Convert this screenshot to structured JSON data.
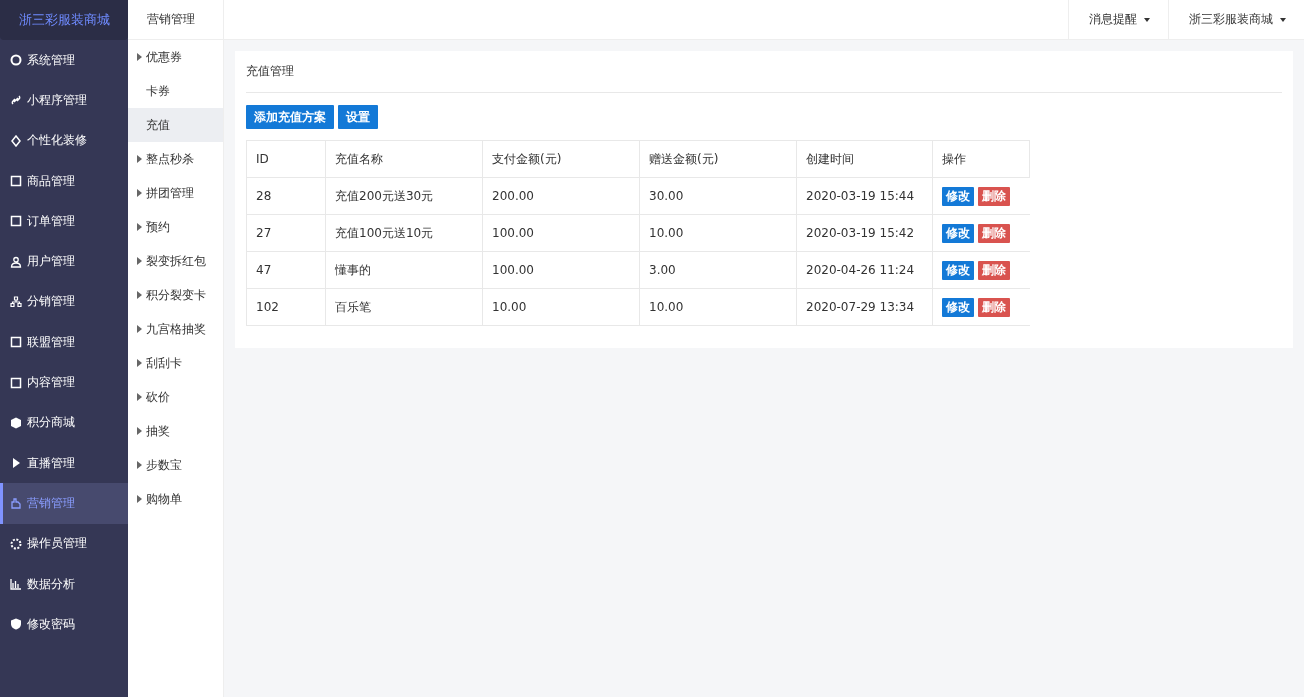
{
  "brand": {
    "title": "浙三彩服装商城"
  },
  "sidebar": {
    "items": [
      {
        "label": "系统管理",
        "selected": false
      },
      {
        "label": "小程序管理",
        "selected": false
      },
      {
        "label": "个性化装修",
        "selected": false
      },
      {
        "label": "商品管理",
        "selected": false
      },
      {
        "label": "订单管理",
        "selected": false
      },
      {
        "label": "用户管理",
        "selected": false
      },
      {
        "label": "分销管理",
        "selected": false
      },
      {
        "label": "联盟管理",
        "selected": false
      },
      {
        "label": "内容管理",
        "selected": false
      },
      {
        "label": "积分商城",
        "selected": false
      },
      {
        "label": "直播管理",
        "selected": false
      },
      {
        "label": "营销管理",
        "selected": true
      },
      {
        "label": "操作员管理",
        "selected": false
      },
      {
        "label": "数据分析",
        "selected": false
      },
      {
        "label": "修改密码",
        "selected": false
      }
    ]
  },
  "submenu": {
    "title": "营销管理",
    "items": [
      {
        "label": "优惠券",
        "expandable": true,
        "selected": false
      },
      {
        "label": "卡券",
        "expandable": false,
        "selected": false
      },
      {
        "label": "充值",
        "expandable": false,
        "selected": true
      },
      {
        "label": "整点秒杀",
        "expandable": true,
        "selected": false
      },
      {
        "label": "拼团管理",
        "expandable": true,
        "selected": false
      },
      {
        "label": "预约",
        "expandable": true,
        "selected": false
      },
      {
        "label": "裂变拆红包",
        "expandable": true,
        "selected": false
      },
      {
        "label": "积分裂变卡",
        "expandable": true,
        "selected": false
      },
      {
        "label": "九宫格抽奖",
        "expandable": true,
        "selected": false
      },
      {
        "label": "刮刮卡",
        "expandable": true,
        "selected": false
      },
      {
        "label": "砍价",
        "expandable": true,
        "selected": false
      },
      {
        "label": "抽奖",
        "expandable": true,
        "selected": false
      },
      {
        "label": "步数宝",
        "expandable": true,
        "selected": false
      },
      {
        "label": "购物单",
        "expandable": true,
        "selected": false
      }
    ]
  },
  "topbar": {
    "menus": [
      "消息提醒",
      "浙三彩服装商城"
    ]
  },
  "panel": {
    "title": "充值管理",
    "buttons": [
      "添加充值方案",
      "设置"
    ],
    "table": {
      "columns": [
        "ID",
        "充值名称",
        "支付金额(元)",
        "赠送金额(元)",
        "创建时间",
        "操作"
      ],
      "rows": [
        {
          "cells": [
            "28",
            "充值200元送30元",
            "200.00",
            "30.00",
            "2020-03-19 15:44"
          ],
          "actions": [
            "修改",
            "删除"
          ]
        },
        {
          "cells": [
            "27",
            "充值100元送10元",
            "100.00",
            "10.00",
            "2020-03-19 15:42"
          ],
          "actions": [
            "修改",
            "删除"
          ]
        },
        {
          "cells": [
            "47",
            "懂事的",
            "100.00",
            "3.00",
            "2020-04-26 11:24"
          ],
          "actions": [
            "修改",
            "删除"
          ]
        },
        {
          "cells": [
            "102",
            "百乐笔",
            "10.00",
            "10.00",
            "2020-07-29 13:34"
          ],
          "actions": [
            "修改",
            "删除"
          ]
        }
      ]
    }
  }
}
